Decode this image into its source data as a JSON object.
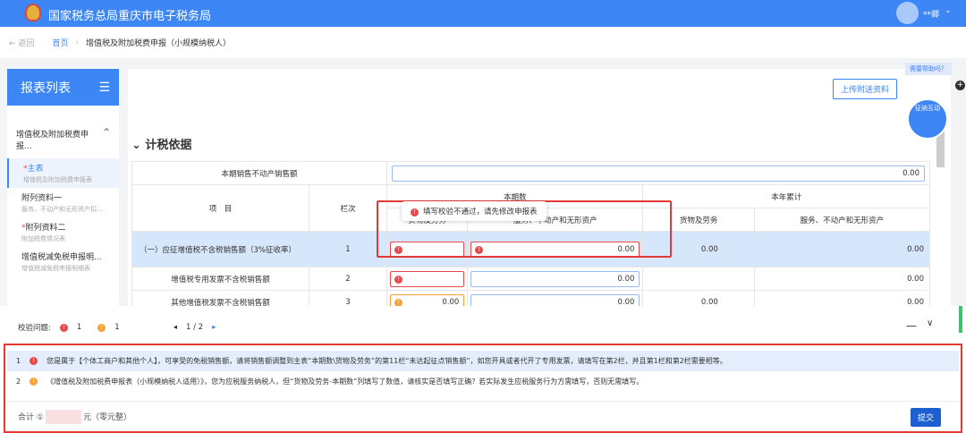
{
  "header": {
    "title": "国家税务总局重庆市电子税务局",
    "user": "**卿"
  },
  "breadcrumb": {
    "back": "返回",
    "home": "首页",
    "current": "增值税及附加税费申报（小规模纳税人）"
  },
  "sidebar": {
    "title": "报表列表",
    "group": "增值税及附加税费申报...",
    "items": [
      {
        "label": "主表",
        "sub": "增值税及附加税费申报表",
        "required": "*"
      },
      {
        "label": "附列资料一",
        "sub": "服务、不动产和无形资产扣...",
        "required": ""
      },
      {
        "label": "附列资料二",
        "sub": "附加税费情况表",
        "required": "*"
      },
      {
        "label": "增值税减免税申报明...",
        "sub": "增值税减免税申报明细表",
        "required": ""
      }
    ]
  },
  "toolbar": {
    "upload": "上传附送资料",
    "help": "需要帮助吗？",
    "assistant": "征纳互动"
  },
  "section": {
    "title": "计税依据"
  },
  "table": {
    "realestate_label": "本期销售不动产销售额",
    "realestate_value": "0.00",
    "h_item": "项　目",
    "h_col": "栏次",
    "h_current": "本期数",
    "h_year": "本年累计",
    "h_goods": "货物及劳务",
    "h_services": "服务、不动产和无形资产",
    "rows": [
      {
        "item": "（一）应征增值税不含税销售额（3%征收率）",
        "col": "1",
        "c3": "",
        "c4": "0.00",
        "c5": "0.00",
        "c6": "0.00"
      },
      {
        "item": "增值税专用发票不含税销售额",
        "col": "2",
        "c3": "",
        "c4": "0.00",
        "c5": "",
        "c6": "0.00"
      },
      {
        "item": "其他增值税发票不含税销售额",
        "col": "3",
        "c3": "0.00",
        "c4": "0.00",
        "c5": "0.00",
        "c6": "0.00"
      }
    ]
  },
  "tooltip": "填写校验不通过，请先修改申报表",
  "check": {
    "label": "校验问题:",
    "errors": "1",
    "warnings": "1",
    "page": "1 / 2",
    "messages": [
      {
        "no": "1",
        "text": "您是属于【个体工商户和其他个人】，可享受的免税销售额，请将销售额调整到主表“本期数\\货物及劳务”的第11栏“未达起征点销售额”，如您开具或者代开了专用发票，请填写在第2栏，并且第1栏和第2栏需要相等。"
      },
      {
        "no": "2",
        "text": "《增值税及附加税费申报表（小规模纳税人适用）》，您为应税服务纳税人，但“货物及劳务-本期数”列填写了数值，请核实是否填写正确？若实际发生应税服务行为方需填写，否则无需填写。"
      }
    ]
  },
  "footer": {
    "total_label": "合计 ①",
    "unit": "元（零元整）",
    "submit": "提交"
  }
}
